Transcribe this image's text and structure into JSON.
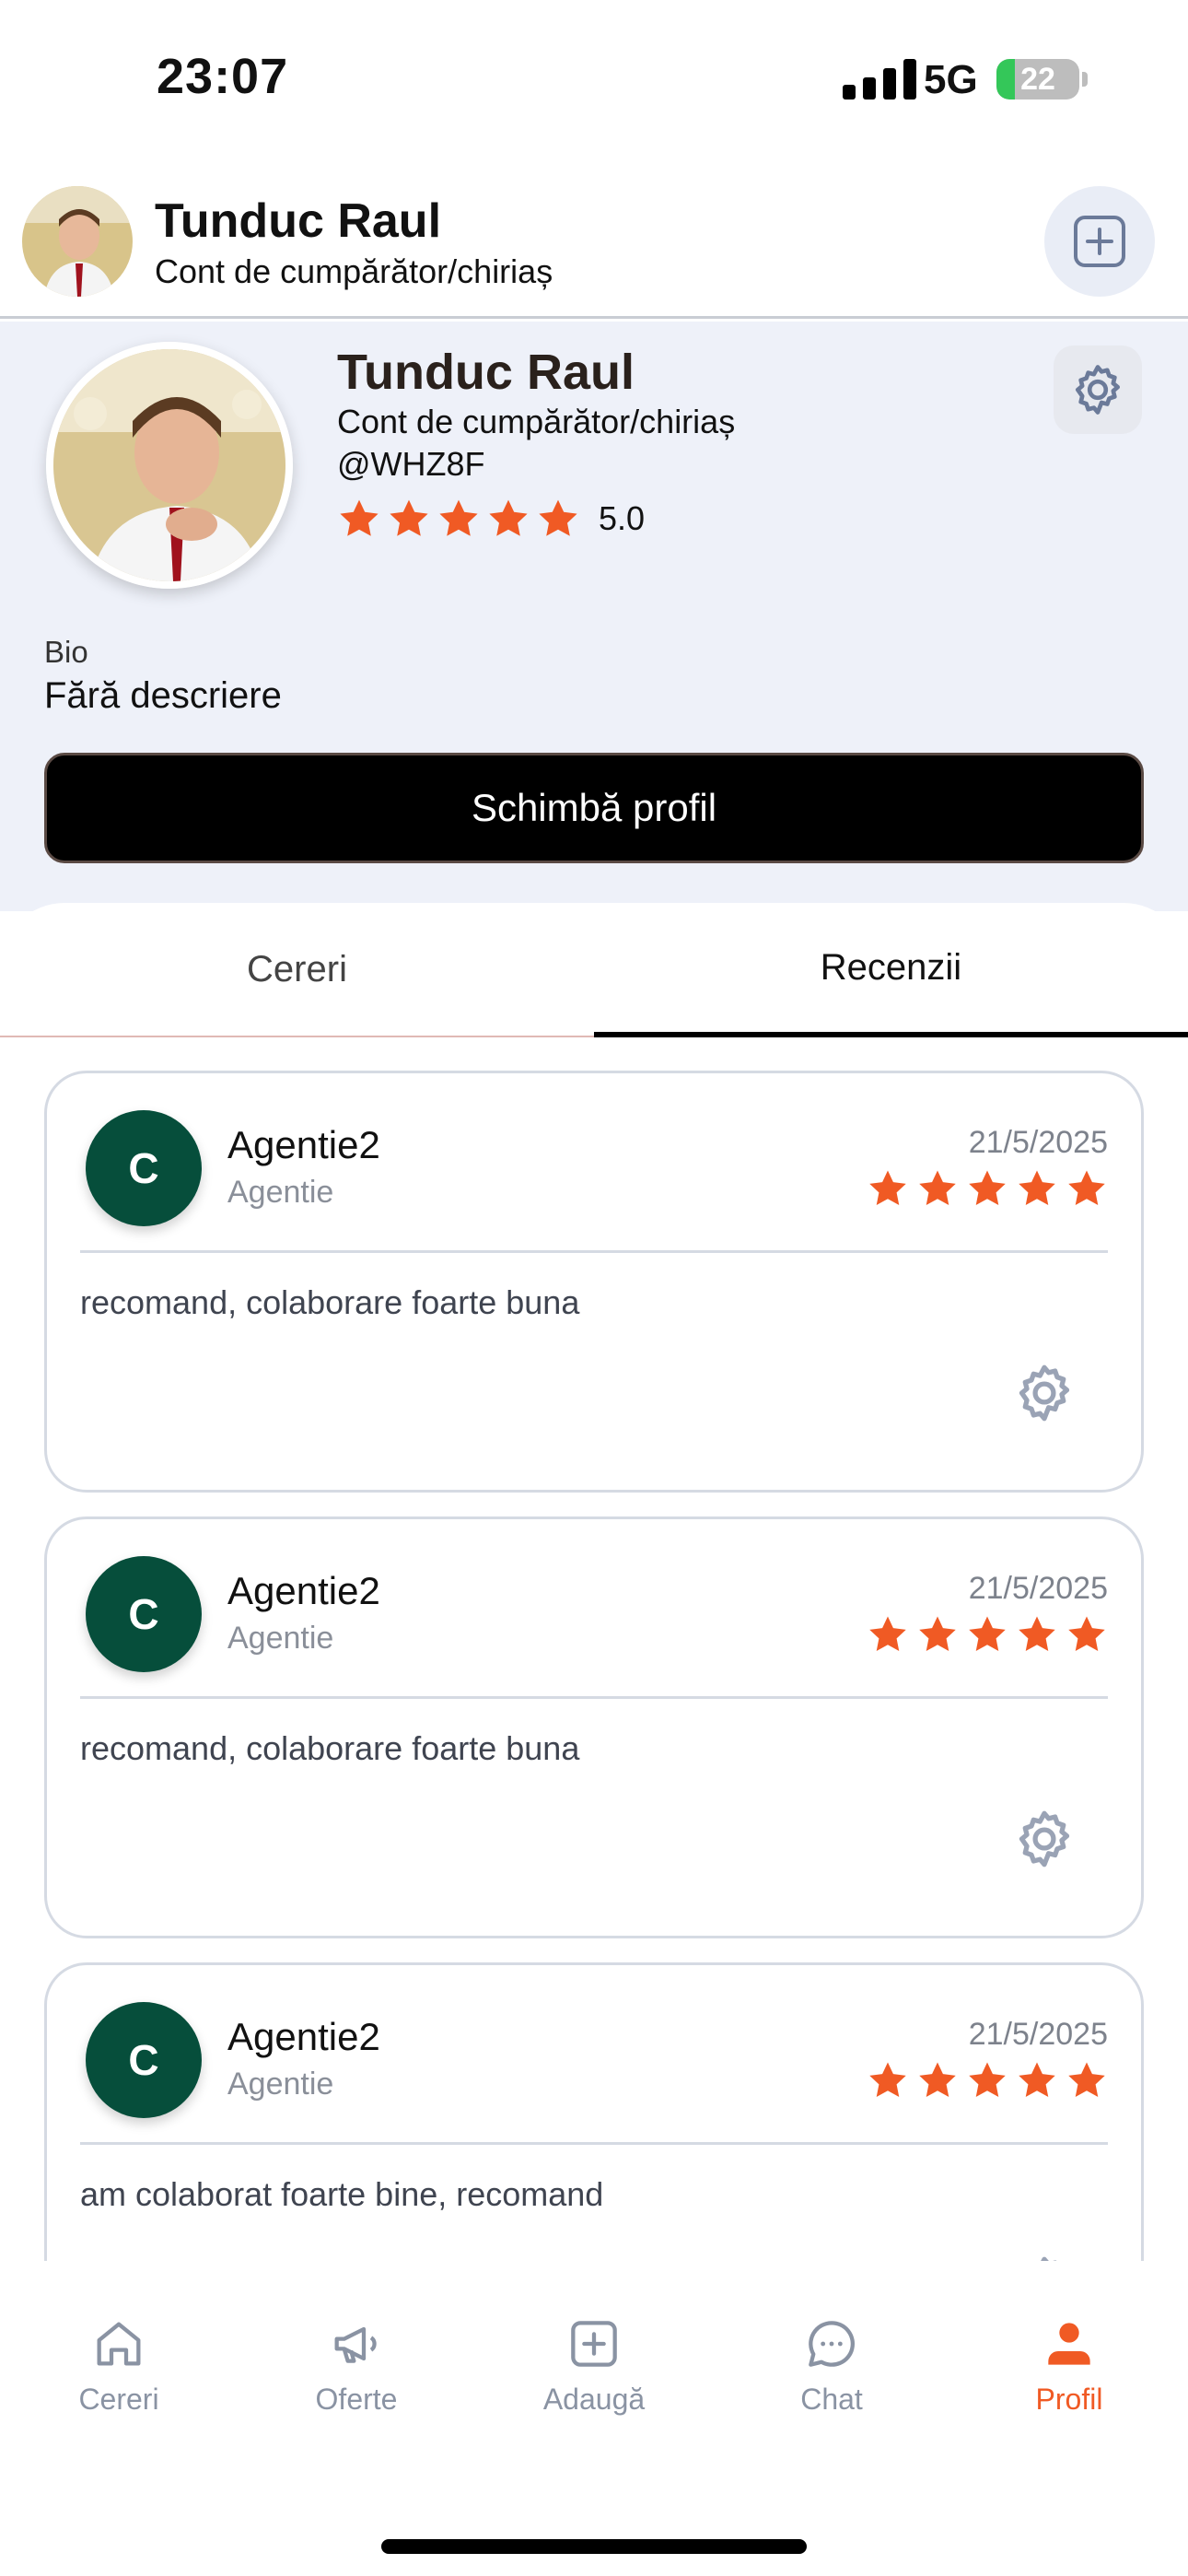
{
  "status_bar": {
    "time": "23:07",
    "network": "5G",
    "battery": "22",
    "battery_level": 0.22
  },
  "header": {
    "name": "Tunduc Raul",
    "subtitle": "Cont de cumpărător/chiriaș"
  },
  "profile": {
    "name": "Tunduc Raul",
    "account_type": "Cont de cumpărător/chiriaș",
    "handle": "@WHZ8F",
    "rating": "5.0",
    "stars": 5,
    "bio_label": "Bio",
    "bio": "Fără descriere",
    "change_profile_label": "Schimbă profil"
  },
  "tabs": [
    {
      "label": "Cereri",
      "active": false
    },
    {
      "label": "Recenzii",
      "active": true
    }
  ],
  "reviews": [
    {
      "initial": "C",
      "name": "Agentie2",
      "role": "Agentie",
      "date": "21/5/2025",
      "stars": 5,
      "text": "recomand, colaborare foarte buna"
    },
    {
      "initial": "C",
      "name": "Agentie2",
      "role": "Agentie",
      "date": "21/5/2025",
      "stars": 5,
      "text": "recomand, colaborare foarte buna"
    },
    {
      "initial": "C",
      "name": "Agentie2",
      "role": "Agentie",
      "date": "21/5/2025",
      "stars": 5,
      "text": "am colaborat foarte bine, recomand"
    }
  ],
  "nav": [
    {
      "label": "Cereri",
      "icon": "home-icon",
      "active": false
    },
    {
      "label": "Oferte",
      "icon": "megaphone-icon",
      "active": false
    },
    {
      "label": "Adaugă",
      "icon": "plus-square-icon",
      "active": false
    },
    {
      "label": "Chat",
      "icon": "chat-bubble-icon",
      "active": false
    },
    {
      "label": "Profil",
      "icon": "person-icon",
      "active": true
    }
  ],
  "colors": {
    "accent": "#f05a24",
    "avatar_bg": "#064e3b",
    "profile_bg": "#eef1f9",
    "nav_inactive": "#8a93a3"
  }
}
